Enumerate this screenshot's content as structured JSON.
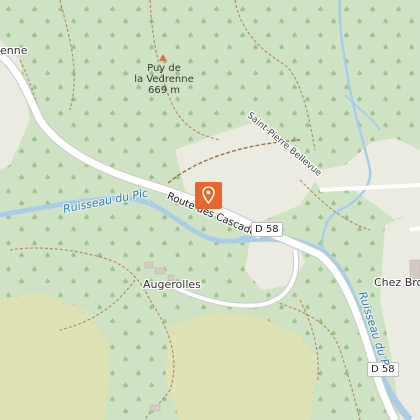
{
  "map": {
    "colors": {
      "forest": "#cfe3c4",
      "clearing": "#ecebe2",
      "river": "#a9cde8",
      "road": "#ffffff",
      "path": "#b08f6a",
      "marker": "#e8652b",
      "meadow": "#dfe2b4"
    },
    "labels": {
      "place_top_left": "enne",
      "peak_name_line1": "Puy de",
      "peak_name_line2": "la Vedrenne",
      "peak_elevation": "669 m",
      "street_saint_pierre": "Saint-Pierre Bellevue",
      "stream_pic": "Ruisseau du Pic",
      "road_cascades": "Route des Cascades",
      "road_shield_1": "D 58",
      "road_shield_2": "D 58",
      "village_augerolles": "Augerolles",
      "village_chez_bro": "Chez Bro",
      "stream_right": "Ruisseau du P"
    },
    "marker": {
      "icon": "map-pin-icon"
    }
  }
}
